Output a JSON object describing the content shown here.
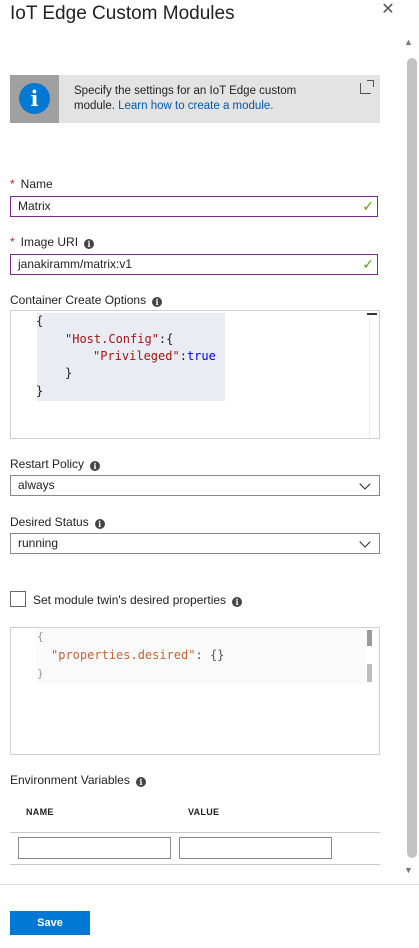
{
  "header": {
    "title": "IoT Edge Custom Modules",
    "close_icon": "close-icon"
  },
  "info_banner": {
    "text": "Specify the settings for an IoT Edge custom module.",
    "link": "Learn how to create a module.",
    "icon": "info-icon",
    "external_icon": "external-link-icon"
  },
  "fields": {
    "name": {
      "label": "Name",
      "required_marker": "*",
      "value": "Matrix"
    },
    "image_uri": {
      "label": "Image URI",
      "required_marker": "*",
      "value": "janakiramm/matrix:v1"
    },
    "container_create_options": {
      "label": "Container Create Options",
      "code_lines": [
        "{",
        "\"Host.Config\":{",
        "\"Privileged\":true",
        "}",
        "}"
      ]
    },
    "restart_policy": {
      "label": "Restart Policy",
      "value": "always"
    },
    "desired_status": {
      "label": "Desired Status",
      "value": "running"
    },
    "twin_checkbox": {
      "label": "Set module twin's desired properties",
      "checked": false
    },
    "twin_editor": {
      "code_lines": [
        "{",
        "\"properties.desired\"",
        ": {}",
        "}"
      ]
    },
    "env_vars": {
      "label": "Environment Variables",
      "columns": [
        "NAME",
        "VALUE"
      ]
    }
  },
  "footer": {
    "save_label": "Save"
  },
  "colors": {
    "accent": "#0078d4",
    "valid": "#57a300",
    "required": "#c4262e",
    "focus_border": "#7a2a8e"
  }
}
